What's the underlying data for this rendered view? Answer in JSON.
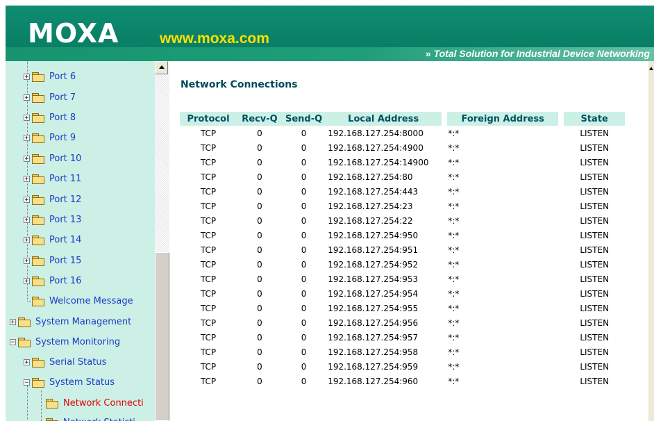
{
  "header": {
    "logo": "MOXA",
    "url": "www.moxa.com",
    "tagline_arrows": "»",
    "tagline": "Total Solution for Industrial Device Networking"
  },
  "colors": {
    "header_green": "#0f8c72",
    "sidebar_bg": "#ccf0e6",
    "link_blue": "#1a3cc8",
    "active_red": "#e00000",
    "title_teal": "#004a5a"
  },
  "sidebar": {
    "items": [
      {
        "label": "Port 6",
        "expander": "+",
        "icon": "folder-icon"
      },
      {
        "label": "Port 7",
        "expander": "+",
        "icon": "folder-icon"
      },
      {
        "label": "Port 8",
        "expander": "+",
        "icon": "folder-icon"
      },
      {
        "label": "Port 9",
        "expander": "+",
        "icon": "folder-icon"
      },
      {
        "label": "Port 10",
        "expander": "+",
        "icon": "folder-icon"
      },
      {
        "label": "Port 11",
        "expander": "+",
        "icon": "folder-icon"
      },
      {
        "label": "Port 12",
        "expander": "+",
        "icon": "folder-icon"
      },
      {
        "label": "Port 13",
        "expander": "+",
        "icon": "folder-icon"
      },
      {
        "label": "Port 14",
        "expander": "+",
        "icon": "folder-icon"
      },
      {
        "label": "Port 15",
        "expander": "+",
        "icon": "folder-icon"
      },
      {
        "label": "Port 16",
        "expander": "+",
        "icon": "folder-icon"
      },
      {
        "label": "Welcome Message",
        "expander": "",
        "icon": "folder-icon"
      },
      {
        "label": "System Management",
        "expander": "+",
        "icon": "folder-icon"
      },
      {
        "label": "System Monitoring",
        "expander": "−",
        "icon": "open-folder-icon"
      },
      {
        "label": "Serial Status",
        "expander": "+",
        "icon": "folder-icon"
      },
      {
        "label": "System Status",
        "expander": "−",
        "icon": "open-folder-icon"
      },
      {
        "label": "Network Connecti",
        "expander": "",
        "icon": "folder-icon"
      },
      {
        "label": "Network Statisti",
        "expander": "",
        "icon": "folder-icon"
      }
    ]
  },
  "main": {
    "title": "Network Connections",
    "columns": [
      "Protocol",
      "Recv-Q",
      "Send-Q",
      "Local Address",
      "Foreign Address",
      "State"
    ],
    "rows": [
      [
        "TCP",
        "0",
        "0",
        "192.168.127.254:8000",
        "*:*",
        "LISTEN"
      ],
      [
        "TCP",
        "0",
        "0",
        "192.168.127.254:4900",
        "*:*",
        "LISTEN"
      ],
      [
        "TCP",
        "0",
        "0",
        "192.168.127.254:14900",
        "*:*",
        "LISTEN"
      ],
      [
        "TCP",
        "0",
        "0",
        "192.168.127.254:80",
        "*:*",
        "LISTEN"
      ],
      [
        "TCP",
        "0",
        "0",
        "192.168.127.254:443",
        "*:*",
        "LISTEN"
      ],
      [
        "TCP",
        "0",
        "0",
        "192.168.127.254:23",
        "*:*",
        "LISTEN"
      ],
      [
        "TCP",
        "0",
        "0",
        "192.168.127.254:22",
        "*:*",
        "LISTEN"
      ],
      [
        "TCP",
        "0",
        "0",
        "192.168.127.254:950",
        "*:*",
        "LISTEN"
      ],
      [
        "TCP",
        "0",
        "0",
        "192.168.127.254:951",
        "*:*",
        "LISTEN"
      ],
      [
        "TCP",
        "0",
        "0",
        "192.168.127.254:952",
        "*:*",
        "LISTEN"
      ],
      [
        "TCP",
        "0",
        "0",
        "192.168.127.254:953",
        "*:*",
        "LISTEN"
      ],
      [
        "TCP",
        "0",
        "0",
        "192.168.127.254:954",
        "*:*",
        "LISTEN"
      ],
      [
        "TCP",
        "0",
        "0",
        "192.168.127.254:955",
        "*:*",
        "LISTEN"
      ],
      [
        "TCP",
        "0",
        "0",
        "192.168.127.254:956",
        "*:*",
        "LISTEN"
      ],
      [
        "TCP",
        "0",
        "0",
        "192.168.127.254:957",
        "*:*",
        "LISTEN"
      ],
      [
        "TCP",
        "0",
        "0",
        "192.168.127.254:958",
        "*:*",
        "LISTEN"
      ],
      [
        "TCP",
        "0",
        "0",
        "192.168.127.254:959",
        "*:*",
        "LISTEN"
      ],
      [
        "TCP",
        "0",
        "0",
        "192.168.127.254:960",
        "*:*",
        "LISTEN"
      ]
    ]
  }
}
